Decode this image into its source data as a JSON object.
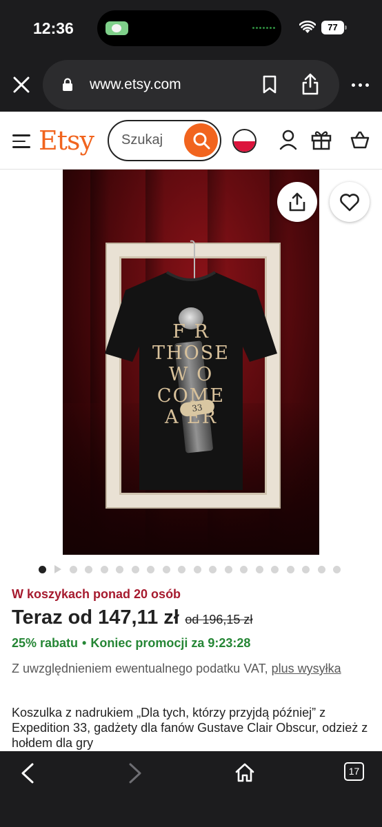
{
  "status": {
    "time": "12:36",
    "battery": "77"
  },
  "browser": {
    "url": "www.etsy.com",
    "tab_count": "17"
  },
  "header": {
    "logo": "Etsy",
    "search_placeholder": "Szukaj",
    "accent_color": "#f1641e"
  },
  "product": {
    "shirt_lines": [
      "F   R",
      "THOSE",
      "W   O",
      "COME",
      "A   ER"
    ],
    "badge": "33",
    "image_count": 20,
    "active_image": 1,
    "cart_count_text": "W koszykach ponad 20 osób",
    "price_now": "Teraz od 147,11 zł",
    "price_old": "od 196,15 zł",
    "discount": "25% rabatu",
    "promo_separator": "•",
    "promo_end": "Koniec promocji za 9:23:28",
    "vat_text": "Z uwzględnieniem ewentualnego podatku VAT,",
    "vat_link": "plus wysyłka",
    "description": "Koszulka z nadrukiem „Dla tych, którzy przyjdą później” z Expedition 33, gadżety dla fanów Gustave Clair Obscur, odzież z hołdem dla gry"
  },
  "colors": {
    "sale_red": "#a61a2e",
    "promo_green": "#258635"
  },
  "icons": {
    "close": "close-icon",
    "lock": "lock-icon",
    "bookmark": "bookmark-icon",
    "share": "share-icon",
    "more": "more-icon",
    "menu": "hamburger-icon",
    "search": "search-icon",
    "flag": "poland-flag-icon",
    "user": "user-icon",
    "gift": "gift-icon",
    "cart": "basket-icon",
    "favorite": "heart-icon",
    "back": "chevron-left-icon",
    "forward": "chevron-right-icon",
    "home": "home-icon",
    "tabs": "tabs-icon"
  }
}
